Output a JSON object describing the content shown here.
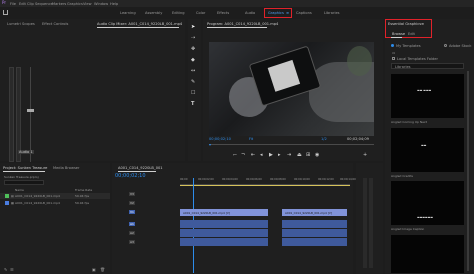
{
  "menubar": [
    "File",
    "Edit",
    "Clip",
    "Sequence",
    "Markers",
    "Graphics",
    "View",
    "Window",
    "Help"
  ],
  "workspaces": [
    "Learning",
    "Assembly",
    "Editing",
    "Color",
    "Effects",
    "Audio",
    "Graphics",
    "Captions",
    "Libraries"
  ],
  "active_workspace": "Graphics",
  "source_tabs": [
    "Lumetri Scopes",
    "Effect Controls",
    "Audio Clip Mixer: A001_C014_9220LB_001.mp4"
  ],
  "program": {
    "title": "Program: A001_C014_9220LB_001.mp4",
    "tc_left": "00;00;02;10",
    "tc_right": "00;02;04;09",
    "zoom": "Fit",
    "quality": "1/2",
    "playhead": 0.25
  },
  "essential_graphics": {
    "title": "Essential Graphics",
    "tabs": [
      "Browse",
      "Edit"
    ],
    "my_templates": "My Templates",
    "adobe_stock": "Adobe Stock",
    "local_folder": "Local Templates Folder",
    "search_placeholder": "Libraries",
    "templates": [
      {
        "name": "Angled Coming Up Next"
      },
      {
        "name": "Angled Credits"
      },
      {
        "name": "Angled Image Caption"
      }
    ]
  },
  "audio_meter": {
    "label": "Audio 1"
  },
  "project": {
    "tabs": [
      "Project: Sunken Treasure",
      "Media Browser"
    ],
    "path": "Sunken Treasure.prproj",
    "columns": [
      "Name",
      "Frame Rate"
    ],
    "items": [
      {
        "name": "A001_C014_9220LB_001.mp4",
        "rate": "59.94 fps",
        "color": "#4fbf5a"
      },
      {
        "name": "A001_C014_9220LB_001.mp4",
        "rate": "59.94 fps",
        "color": "#4a7de0"
      }
    ]
  },
  "timeline": {
    "tab": "A001_C014_9220LB_001",
    "timecode": "00;00;02;10",
    "ruler": [
      "00;00",
      "00;00;02;00",
      "00;00;04;00",
      "00;00;06;00",
      "00;00;08;00",
      "00;00;10;00",
      "00;00;12;00",
      "00;00;14;00"
    ],
    "tracks": [
      "V3",
      "V2",
      "V1",
      "A1",
      "A2",
      "A3"
    ],
    "clips": [
      {
        "track": "V1",
        "label": "A001_C014_9220LB_001.mp4 [V]"
      },
      {
        "track": "V1",
        "label": "A001_C014_9220LB_001.mp4 [V]"
      }
    ]
  },
  "colors": {
    "accent": "#2d8ceb",
    "highlight": "#e0222a",
    "clip_video": "#8193d9",
    "clip_audio": "#3f5a9c"
  }
}
